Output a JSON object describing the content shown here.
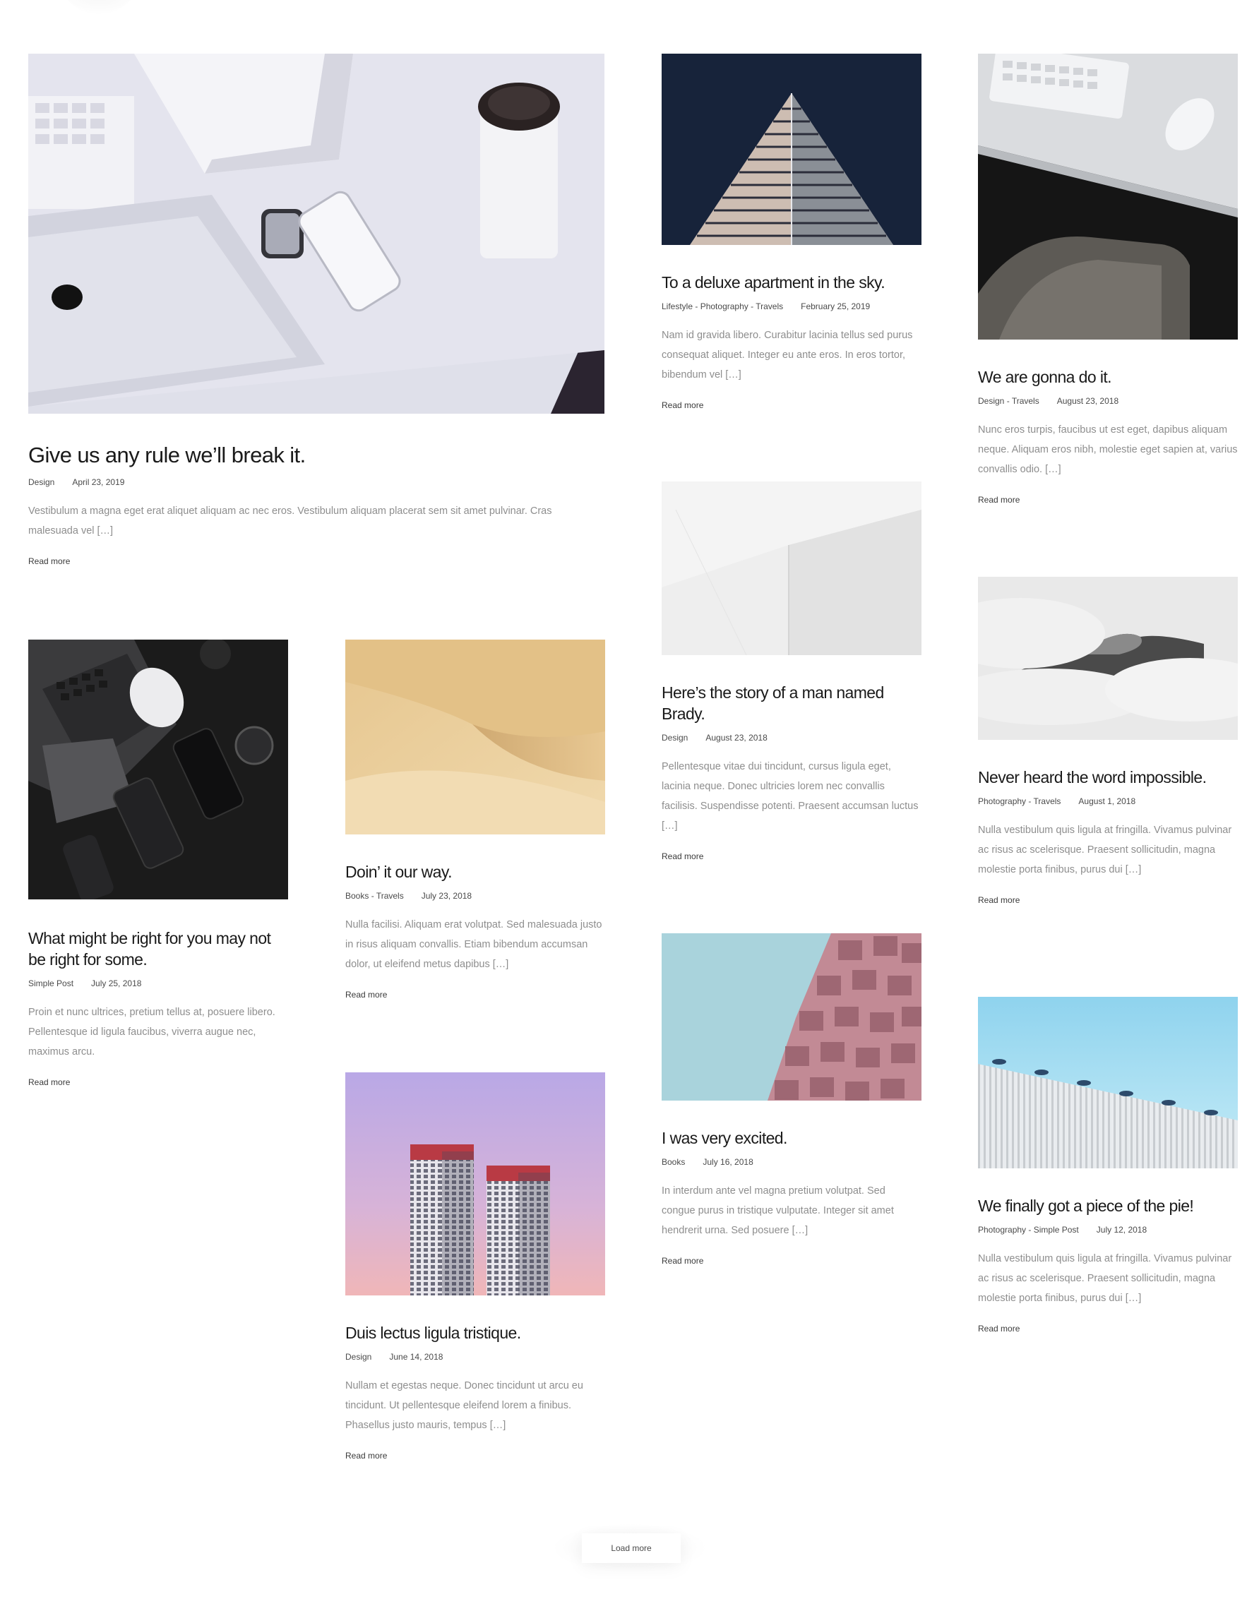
{
  "posts": [
    {
      "title": "Give us any rule we’ll break it.",
      "categories": [
        "Design"
      ],
      "date": "April 23, 2019",
      "excerpt": "Vestibulum a magna eget erat aliquet aliquam ac nec eros. Vestibulum aliquam placerat sem sit amet pulvinar. Cras malesuada vel […]",
      "read_more": "Read more",
      "image": "desk-setup-white"
    },
    {
      "title": "To a deluxe apartment in the sky.",
      "categories": [
        "Lifestyle",
        "Photography",
        "Travels"
      ],
      "date": "February 25, 2019",
      "excerpt": "Nam id gravida libero. Curabitur lacinia tellus sed purus consequat aliquet. Integer eu ante eros. In eros tortor, bibendum vel […]",
      "read_more": "Read more",
      "image": "skyscraper-corner"
    },
    {
      "title": "We are gonna do it.",
      "categories": [
        "Design",
        "Travels"
      ],
      "date": "August 23, 2018",
      "excerpt": "Nunc eros turpis, faucibus ut est eget, dapibus aliquam neque. Aliquam eros nibh, molestie eget sapien at, varius convallis odio. […]",
      "read_more": "Read more",
      "image": "keyboard-mouse-desk"
    },
    {
      "title": "What might be right for you may not be right for some.",
      "categories": [
        "Simple Post"
      ],
      "date": "July 25, 2018",
      "excerpt": "Proin et nunc ultrices, pretium tellus at, posuere libero. Pellentesque id ligula faucibus, viverra augue nec, maximus arcu.",
      "read_more": "Read more",
      "image": "dark-desk-gadgets"
    },
    {
      "title": "Doin’ it our way.",
      "categories": [
        "Books",
        "Travels"
      ],
      "date": "July 23, 2018",
      "excerpt": "Nulla facilisi. Aliquam erat volutpat. Sed malesuada justo in risus aliquam convallis. Etiam bibendum accumsan dolor, ut eleifend metus dapibus […]",
      "read_more": "Read more",
      "image": "sand-dune"
    },
    {
      "title": "Here’s the story of a man named Brady.",
      "categories": [
        "Design"
      ],
      "date": "August 23, 2018",
      "excerpt": "Pellentesque vitae dui tincidunt, cursus ligula eget, lacinia neque. Donec ultricies lorem nec convallis facilisis. Suspendisse potenti. Praesent accumsan luctus […]",
      "read_more": "Read more",
      "image": "white-architecture"
    },
    {
      "title": "Never heard the word impossible.",
      "categories": [
        "Photography",
        "Travels"
      ],
      "date": "August 1, 2018",
      "excerpt": "Nulla vestibulum quis ligula at fringilla. Vivamus pulvinar ac risus ac scelerisque. Praesent sollicitudin, magna molestie porta finibus, purus dui […]",
      "read_more": "Read more",
      "image": "misty-mountain"
    },
    {
      "title": "I was very excited.",
      "categories": [
        "Books"
      ],
      "date": "July 16, 2018",
      "excerpt": "In interdum ante vel magna pretium volutpat. Sed congue purus in tristique vulputate. Integer sit amet hendrerit urna. Sed posuere […]",
      "read_more": "Read more",
      "image": "pink-balconies"
    },
    {
      "title": "We finally got a piece of the pie!",
      "categories": [
        "Photography",
        "Simple Post"
      ],
      "date": "July 12, 2018",
      "excerpt": "Nulla vestibulum quis ligula at fringilla. Vivamus pulvinar ac risus ac scelerisque. Praesent sollicitudin, magna molestie porta finibus, purus dui […]",
      "read_more": "Read more",
      "image": "fence-solar-sky"
    },
    {
      "title": "Duis lectus ligula tristique.",
      "categories": [
        "Design"
      ],
      "date": "June 14, 2018",
      "excerpt": "Nullam et egestas neque. Donec tincidunt ut arcu eu tincidunt. Ut pellentesque eleifend lorem a finibus. Phasellus justo mauris, tempus […]",
      "read_more": "Read more",
      "image": "twin-towers-pastel"
    }
  ],
  "load_more": "Load more"
}
